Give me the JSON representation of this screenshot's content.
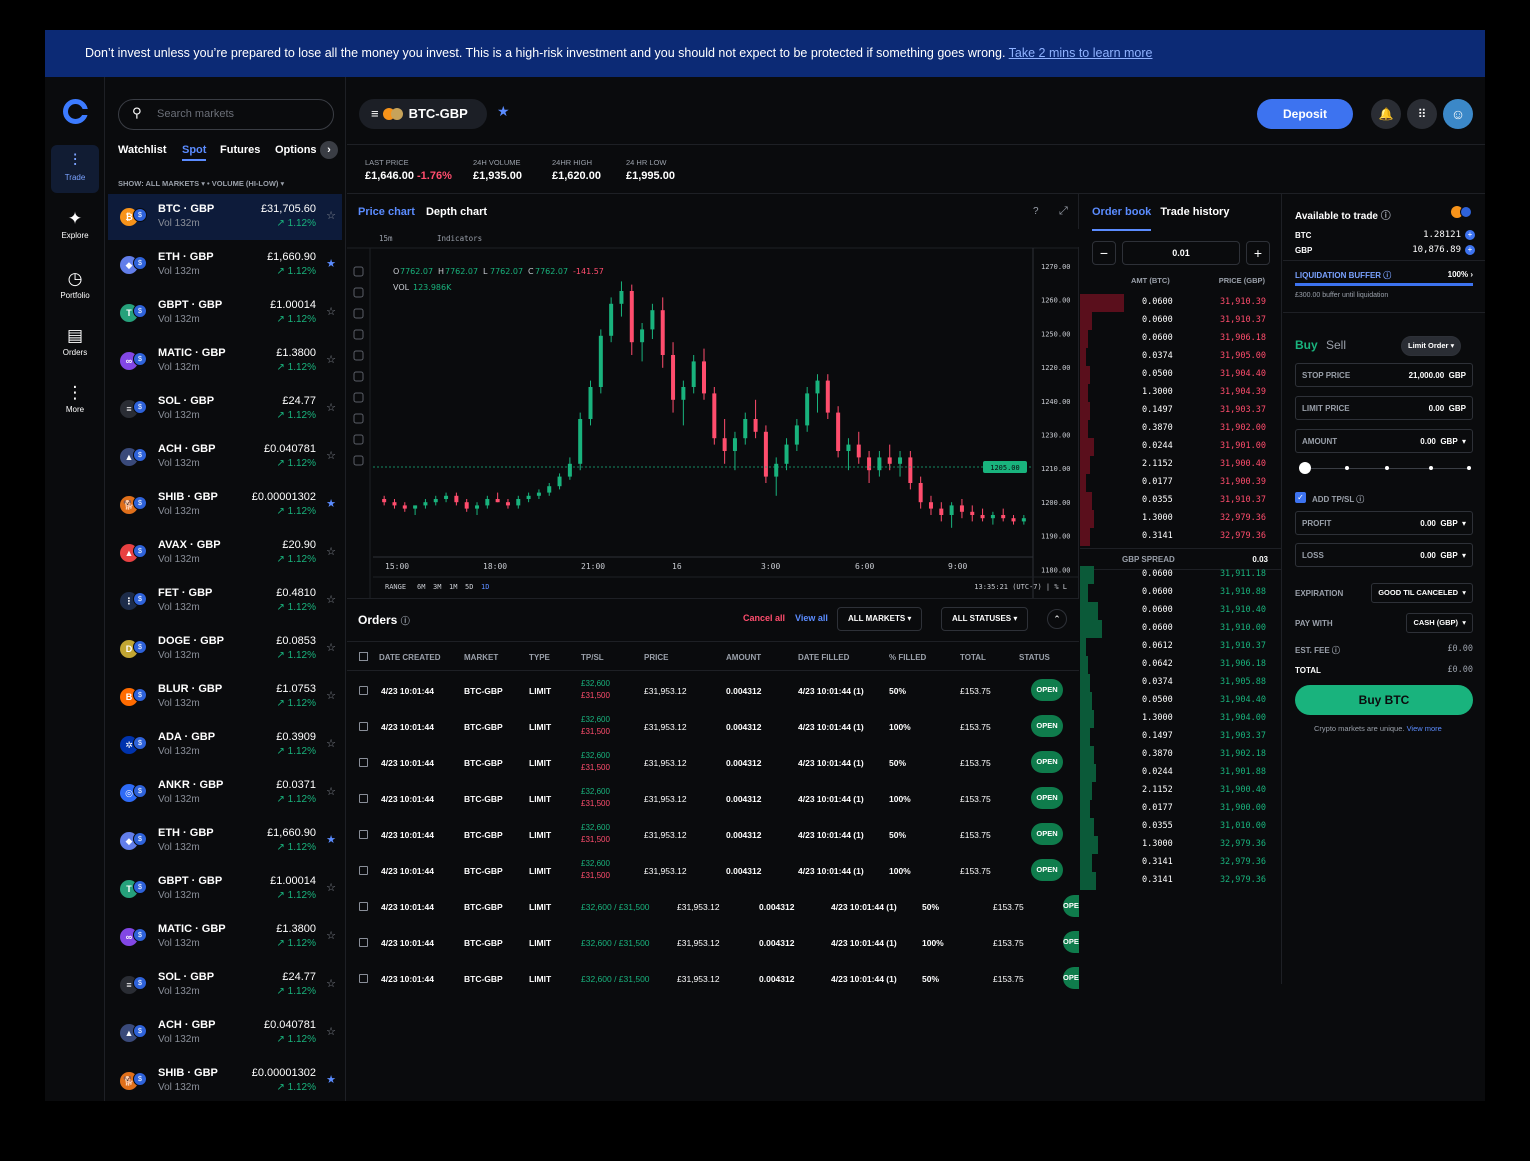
{
  "banner": {
    "text": "Don’t invest unless you’re prepared to lose all the money you invest. This is a high-risk investment and you should not expect to be protected if something goes wrong. ",
    "link": "Take 2 mins to learn more"
  },
  "rail": [
    {
      "label": "Trade",
      "icon": "trade-icon"
    },
    {
      "label": "Explore",
      "icon": "explore-icon"
    },
    {
      "label": "Portfolio",
      "icon": "portfolio-icon"
    },
    {
      "label": "Orders",
      "icon": "orders-icon"
    },
    {
      "label": "More",
      "icon": "more-icon"
    }
  ],
  "search": {
    "placeholder": "Search markets"
  },
  "market_tabs": [
    "Watchlist",
    "Spot",
    "Futures",
    "Options"
  ],
  "filter": "SHOW: ALL MARKETS ▾ • VOLUME (HI-LOW) ▾",
  "markets": [
    {
      "pair": "BTC · GBP",
      "vol": "Vol 132m",
      "price": "£31,705.60",
      "chg": "↗ 1.12%",
      "color": "#f7931a",
      "sym": "₿",
      "starred": false
    },
    {
      "pair": "ETH · GBP",
      "vol": "Vol 132m",
      "price": "£1,660.90",
      "chg": "↗ 1.12%",
      "color": "#627eea",
      "sym": "◆",
      "starred": true
    },
    {
      "pair": "GBPT · GBP",
      "vol": "Vol 132m",
      "price": "£1.00014",
      "chg": "↗ 1.12%",
      "color": "#26a17b",
      "sym": "T",
      "starred": false
    },
    {
      "pair": "MATIC · GBP",
      "vol": "Vol 132m",
      "price": "£1.3800",
      "chg": "↗ 1.12%",
      "color": "#8247e5",
      "sym": "∞",
      "starred": false
    },
    {
      "pair": "SOL · GBP",
      "vol": "Vol 132m",
      "price": "£24.77",
      "chg": "↗ 1.12%",
      "color": "#2a2d34",
      "sym": "≡",
      "starred": false
    },
    {
      "pair": "ACH · GBP",
      "vol": "Vol 132m",
      "price": "£0.040781",
      "chg": "↗ 1.12%",
      "color": "#3a4a7a",
      "sym": "▲",
      "starred": false
    },
    {
      "pair": "SHIB · GBP",
      "vol": "Vol 132m",
      "price": "£0.00001302",
      "chg": "↗ 1.12%",
      "color": "#e0701b",
      "sym": "🐕",
      "starred": true
    },
    {
      "pair": "AVAX · GBP",
      "vol": "Vol 132m",
      "price": "£20.90",
      "chg": "↗ 1.12%",
      "color": "#e84142",
      "sym": "▲",
      "starred": false
    },
    {
      "pair": "FET · GBP",
      "vol": "Vol 132m",
      "price": "£0.4810",
      "chg": "↗ 1.12%",
      "color": "#1d2c4a",
      "sym": "⋮",
      "starred": false
    },
    {
      "pair": "DOGE · GBP",
      "vol": "Vol 132m",
      "price": "£0.0853",
      "chg": "↗ 1.12%",
      "color": "#c2a633",
      "sym": "D",
      "starred": false
    },
    {
      "pair": "BLUR · GBP",
      "vol": "Vol 132m",
      "price": "£1.0753",
      "chg": "↗ 1.12%",
      "color": "#ff6b00",
      "sym": "B",
      "starred": false
    },
    {
      "pair": "ADA · GBP",
      "vol": "Vol 132m",
      "price": "£0.3909",
      "chg": "↗ 1.12%",
      "color": "#0033ad",
      "sym": "✲",
      "starred": false
    },
    {
      "pair": "ANKR · GBP",
      "vol": "Vol 132m",
      "price": "£0.0371",
      "chg": "↗ 1.12%",
      "color": "#2e6bf6",
      "sym": "◎",
      "starred": false
    },
    {
      "pair": "ETH · GBP",
      "vol": "Vol 132m",
      "price": "£1,660.90",
      "chg": "↗ 1.12%",
      "color": "#627eea",
      "sym": "◆",
      "starred": true
    },
    {
      "pair": "GBPT · GBP",
      "vol": "Vol 132m",
      "price": "£1.00014",
      "chg": "↗ 1.12%",
      "color": "#26a17b",
      "sym": "T",
      "starred": false
    },
    {
      "pair": "MATIC · GBP",
      "vol": "Vol 132m",
      "price": "£1.3800",
      "chg": "↗ 1.12%",
      "color": "#8247e5",
      "sym": "∞",
      "starred": false
    },
    {
      "pair": "SOL · GBP",
      "vol": "Vol 132m",
      "price": "£24.77",
      "chg": "↗ 1.12%",
      "color": "#2a2d34",
      "sym": "≡",
      "starred": false
    },
    {
      "pair": "ACH · GBP",
      "vol": "Vol 132m",
      "price": "£0.040781",
      "chg": "↗ 1.12%",
      "color": "#3a4a7a",
      "sym": "▲",
      "starred": false
    },
    {
      "pair": "SHIB · GBP",
      "vol": "Vol 132m",
      "price": "£0.00001302",
      "chg": "↗ 1.12%",
      "color": "#e0701b",
      "sym": "🐕",
      "starred": true
    }
  ],
  "header": {
    "pair": "BTC-GBP",
    "deposit": "Deposit"
  },
  "stats": [
    {
      "label": "LAST PRICE",
      "value": "£1,646.00",
      "extra": "-1.76%"
    },
    {
      "label": "24H VOLUME",
      "value": "£1,935.00"
    },
    {
      "label": "24HR HIGH",
      "value": "£1,620.00"
    },
    {
      "label": "24 HR LOW",
      "value": "£1,995.00"
    }
  ],
  "chart_tabs": [
    "Price chart",
    "Depth chart"
  ],
  "chart": {
    "interval": "15m",
    "indicators": "Indicators",
    "ohlc": {
      "o": "7762.07",
      "h": "7762.07",
      "l": "7762.07",
      "c": "7762.07",
      "chg": "-141.57"
    },
    "volume": "123.986K",
    "y_ticks": [
      "1270.00",
      "1260.00",
      "1250.00",
      "1220.00",
      "1240.00",
      "1230.00",
      "1210.00",
      "1200.00",
      "1190.00",
      "1180.00"
    ],
    "x_ticks": [
      "15:00",
      "18:00",
      "21:00",
      "16",
      "3:00",
      "6:00",
      "9:00"
    ],
    "current_price": "1205.00",
    "ranges": [
      "6M",
      "3M",
      "1M",
      "5D",
      "1D"
    ],
    "range_label": "RANGE",
    "footer_right": "13:35:21 (UTC-7)  |  %  L"
  },
  "chart_data": {
    "type": "candlestick",
    "note_units": "price",
    "candles": [
      [
        1195,
        1196,
        1193,
        1194
      ],
      [
        1194,
        1195,
        1192,
        1193
      ],
      [
        1193,
        1194,
        1191,
        1192
      ],
      [
        1192,
        1193,
        1190,
        1193
      ],
      [
        1193,
        1195,
        1192,
        1194
      ],
      [
        1194,
        1196,
        1193,
        1195
      ],
      [
        1195,
        1197,
        1194,
        1196
      ],
      [
        1196,
        1197,
        1193,
        1194
      ],
      [
        1194,
        1195,
        1191,
        1192
      ],
      [
        1192,
        1194,
        1190,
        1193
      ],
      [
        1193,
        1196,
        1192,
        1195
      ],
      [
        1195,
        1197,
        1194,
        1194
      ],
      [
        1194,
        1195,
        1192,
        1193
      ],
      [
        1193,
        1196,
        1192,
        1195
      ],
      [
        1195,
        1197,
        1194,
        1196
      ],
      [
        1196,
        1198,
        1195,
        1197
      ],
      [
        1197,
        1200,
        1196,
        1199
      ],
      [
        1199,
        1203,
        1198,
        1202
      ],
      [
        1202,
        1208,
        1201,
        1206
      ],
      [
        1206,
        1222,
        1204,
        1220
      ],
      [
        1220,
        1232,
        1218,
        1230
      ],
      [
        1230,
        1248,
        1228,
        1246
      ],
      [
        1246,
        1258,
        1244,
        1256
      ],
      [
        1256,
        1263,
        1252,
        1260
      ],
      [
        1260,
        1262,
        1240,
        1244
      ],
      [
        1244,
        1250,
        1238,
        1248
      ],
      [
        1248,
        1256,
        1245,
        1254
      ],
      [
        1254,
        1258,
        1236,
        1240
      ],
      [
        1240,
        1244,
        1222,
        1226
      ],
      [
        1226,
        1232,
        1218,
        1230
      ],
      [
        1230,
        1240,
        1228,
        1238
      ],
      [
        1238,
        1242,
        1226,
        1228
      ],
      [
        1228,
        1230,
        1212,
        1214
      ],
      [
        1214,
        1220,
        1206,
        1210
      ],
      [
        1210,
        1216,
        1204,
        1214
      ],
      [
        1214,
        1222,
        1212,
        1220
      ],
      [
        1220,
        1226,
        1214,
        1216
      ],
      [
        1216,
        1218,
        1200,
        1202
      ],
      [
        1202,
        1208,
        1196,
        1206
      ],
      [
        1206,
        1214,
        1204,
        1212
      ],
      [
        1212,
        1220,
        1210,
        1218
      ],
      [
        1218,
        1230,
        1216,
        1228
      ],
      [
        1228,
        1234,
        1222,
        1232
      ],
      [
        1232,
        1234,
        1220,
        1222
      ],
      [
        1222,
        1224,
        1208,
        1210
      ],
      [
        1210,
        1214,
        1204,
        1212
      ],
      [
        1212,
        1216,
        1206,
        1208
      ],
      [
        1208,
        1210,
        1200,
        1204
      ],
      [
        1204,
        1210,
        1202,
        1208
      ],
      [
        1208,
        1212,
        1204,
        1206
      ],
      [
        1206,
        1210,
        1202,
        1208
      ],
      [
        1208,
        1210,
        1198,
        1200
      ],
      [
        1200,
        1202,
        1192,
        1194
      ],
      [
        1194,
        1196,
        1190,
        1192
      ],
      [
        1192,
        1194,
        1188,
        1190
      ],
      [
        1190,
        1194,
        1186,
        1193
      ],
      [
        1193,
        1195,
        1189,
        1191
      ],
      [
        1191,
        1193,
        1188,
        1190
      ],
      [
        1190,
        1192,
        1188,
        1189
      ],
      [
        1189,
        1191,
        1187,
        1190
      ],
      [
        1190,
        1192,
        1188,
        1189
      ],
      [
        1189,
        1190,
        1187,
        1188
      ],
      [
        1188,
        1190,
        1187,
        1189
      ]
    ],
    "ylim": [
      1180,
      1270
    ]
  },
  "orders": {
    "title": "Orders",
    "cancel_all": "Cancel all",
    "view_all": "View all",
    "filter_markets": "ALL MARKETS",
    "filter_status": "ALL STATUSES",
    "columns": [
      "DATE CREATED",
      "MARKET",
      "TYPE",
      "TP/SL",
      "PRICE",
      "AMOUNT",
      "DATE FILLED",
      "% FILLED",
      "TOTAL",
      "STATUS"
    ],
    "rows": [
      {
        "date": "4/23 10:01:44",
        "market": "BTC-GBP",
        "type": "LIMIT",
        "tp": "£32,600",
        "sl": "£31,500",
        "price": "£31,953.12",
        "amount": "0.004312",
        "filled_date": "4/23 10:01:44 (1)",
        "pct": "50%",
        "total": "£153.75",
        "status": "OPEN"
      },
      {
        "date": "4/23 10:01:44",
        "market": "BTC-GBP",
        "type": "LIMIT",
        "tp": "£32,600",
        "sl": "£31,500",
        "price": "£31,953.12",
        "amount": "0.004312",
        "filled_date": "4/23 10:01:44 (1)",
        "pct": "100%",
        "total": "£153.75",
        "status": "OPEN"
      },
      {
        "date": "4/23 10:01:44",
        "market": "BTC-GBP",
        "type": "LIMIT",
        "tp": "£32,600",
        "sl": "£31,500",
        "price": "£31,953.12",
        "amount": "0.004312",
        "filled_date": "4/23 10:01:44 (1)",
        "pct": "50%",
        "total": "£153.75",
        "status": "OPEN"
      },
      {
        "date": "4/23 10:01:44",
        "market": "BTC-GBP",
        "type": "LIMIT",
        "tp": "£32,600",
        "sl": "£31,500",
        "price": "£31,953.12",
        "amount": "0.004312",
        "filled_date": "4/23 10:01:44 (1)",
        "pct": "100%",
        "total": "£153.75",
        "status": "OPEN"
      },
      {
        "date": "4/23 10:01:44",
        "market": "BTC-GBP",
        "type": "LIMIT",
        "tp": "£32,600",
        "sl": "£31,500",
        "price": "£31,953.12",
        "amount": "0.004312",
        "filled_date": "4/23 10:01:44 (1)",
        "pct": "50%",
        "total": "£153.75",
        "status": "OPEN"
      },
      {
        "date": "4/23 10:01:44",
        "market": "BTC-GBP",
        "type": "LIMIT",
        "tp": "£32,600",
        "sl": "£31,500",
        "price": "£31,953.12",
        "amount": "0.004312",
        "filled_date": "4/23 10:01:44 (1)",
        "pct": "100%",
        "total": "£153.75",
        "status": "OPEN"
      }
    ],
    "rows_inline": [
      {
        "date": "4/23 10:01:44",
        "market": "BTC-GBP",
        "type": "LIMIT",
        "tpsl": "£32,600 / £31,500",
        "price": "£31,953.12",
        "amount": "0.004312",
        "filled_date": "4/23 10:01:44 (1)",
        "pct": "50%",
        "total": "£153.75",
        "status": "OPEN"
      },
      {
        "date": "4/23 10:01:44",
        "market": "BTC-GBP",
        "type": "LIMIT",
        "tpsl": "£32,600 / £31,500",
        "price": "£31,953.12",
        "amount": "0.004312",
        "filled_date": "4/23 10:01:44 (1)",
        "pct": "100%",
        "total": "£153.75",
        "status": "OPEN"
      },
      {
        "date": "4/23 10:01:44",
        "market": "BTC-GBP",
        "type": "LIMIT",
        "tpsl": "£32,600 / £31,500",
        "price": "£31,953.12",
        "amount": "0.004312",
        "filled_date": "4/23 10:01:44 (1)",
        "pct": "50%",
        "total": "£153.75",
        "status": "OPEN"
      }
    ]
  },
  "orderbook": {
    "tabs": [
      "Order book",
      "Trade history"
    ],
    "step": "0.01",
    "col_amt": "AMT (BTC)",
    "col_price": "PRICE (GBP)",
    "spread_label": "GBP SPREAD",
    "spread_value": "0.03",
    "asks": [
      {
        "amt": "0.0600",
        "price": "31,910.39",
        "depth": 0.22
      },
      {
        "amt": "0.0600",
        "price": "31,910.37",
        "depth": 0.06
      },
      {
        "amt": "0.0600",
        "price": "31,906.18",
        "depth": 0.04
      },
      {
        "amt": "0.0374",
        "price": "31,905.00",
        "depth": 0.03
      },
      {
        "amt": "0.0500",
        "price": "31,904.40",
        "depth": 0.05
      },
      {
        "amt": "1.3000",
        "price": "31,904.39",
        "depth": 0.04
      },
      {
        "amt": "0.1497",
        "price": "31,903.37",
        "depth": 0.05
      },
      {
        "amt": "0.3870",
        "price": "31,902.00",
        "depth": 0.04
      },
      {
        "amt": "0.0244",
        "price": "31,901.00",
        "depth": 0.07
      },
      {
        "amt": "2.1152",
        "price": "31,900.40",
        "depth": 0.05
      },
      {
        "amt": "0.0177",
        "price": "31,900.39",
        "depth": 0.03
      },
      {
        "amt": "0.0355",
        "price": "31,910.37",
        "depth": 0.06
      },
      {
        "amt": "1.3000",
        "price": "32,979.36",
        "depth": 0.07
      },
      {
        "amt": "0.3141",
        "price": "32,979.36",
        "depth": 0.05
      }
    ],
    "bids": [
      {
        "amt": "0.0600",
        "price": "31,911.18",
        "depth": 0.07
      },
      {
        "amt": "0.0600",
        "price": "31,910.88",
        "depth": 0.04
      },
      {
        "amt": "0.0600",
        "price": "31,910.40",
        "depth": 0.09
      },
      {
        "amt": "0.0600",
        "price": "31,910.00",
        "depth": 0.11
      },
      {
        "amt": "0.0612",
        "price": "31,910.37",
        "depth": 0.03
      },
      {
        "amt": "0.0642",
        "price": "31,906.18",
        "depth": 0.04
      },
      {
        "amt": "0.0374",
        "price": "31,905.88",
        "depth": 0.05
      },
      {
        "amt": "0.0500",
        "price": "31,904.40",
        "depth": 0.06
      },
      {
        "amt": "1.3000",
        "price": "31,904.00",
        "depth": 0.07
      },
      {
        "amt": "0.1497",
        "price": "31,903.37",
        "depth": 0.05
      },
      {
        "amt": "0.3870",
        "price": "31,902.18",
        "depth": 0.07
      },
      {
        "amt": "0.0244",
        "price": "31,901.88",
        "depth": 0.08
      },
      {
        "amt": "2.1152",
        "price": "31,900.40",
        "depth": 0.06
      },
      {
        "amt": "0.0177",
        "price": "31,900.00",
        "depth": 0.05
      },
      {
        "amt": "0.0355",
        "price": "31,010.00",
        "depth": 0.07
      },
      {
        "amt": "1.3000",
        "price": "32,979.36",
        "depth": 0.09
      },
      {
        "amt": "0.3141",
        "price": "32,979.36",
        "depth": 0.06
      },
      {
        "amt": "0.3141",
        "price": "32,979.36",
        "depth": 0.08
      }
    ]
  },
  "trade": {
    "title": "Available to trade",
    "balances": [
      {
        "asset": "BTC",
        "amount": "1.28121"
      },
      {
        "asset": "GBP",
        "amount": "10,876.89"
      }
    ],
    "liq_label": "LIQUIDATION BUFFER",
    "liq_value": "100%",
    "liq_fill": 1.0,
    "liq_note": "£300.00 buffer until liquidation",
    "buy": "Buy",
    "sell": "Sell",
    "order_type": "Limit Order",
    "stop_label": "STOP PRICE",
    "stop_value": "21,000.00",
    "stop_ccy": "GBP",
    "limit_label": "LIMIT PRICE",
    "limit_value": "0.00",
    "limit_ccy": "GBP",
    "amount_label": "AMOUNT",
    "amount_value": "0.00",
    "amount_ccy": "GBP",
    "slider_value": 0,
    "tpsl_label": "ADD TP/SL",
    "profit_label": "PROFIT",
    "profit_value": "0.00",
    "profit_ccy": "GBP",
    "loss_label": "LOSS",
    "loss_value": "0.00",
    "loss_ccy": "GBP",
    "exp_label": "EXPIRATION",
    "exp_value": "GOOD TIL CANCELED",
    "pay_label": "PAY WITH",
    "pay_value": "CASH (GBP)",
    "fee_label": "EST. FEE",
    "fee_value": "£0.00",
    "total_label": "TOTAL",
    "total_value": "£0.00",
    "buy_button": "Buy BTC",
    "disclaimer": "Crypto markets are unique.",
    "disclaimer_link": "View more"
  }
}
